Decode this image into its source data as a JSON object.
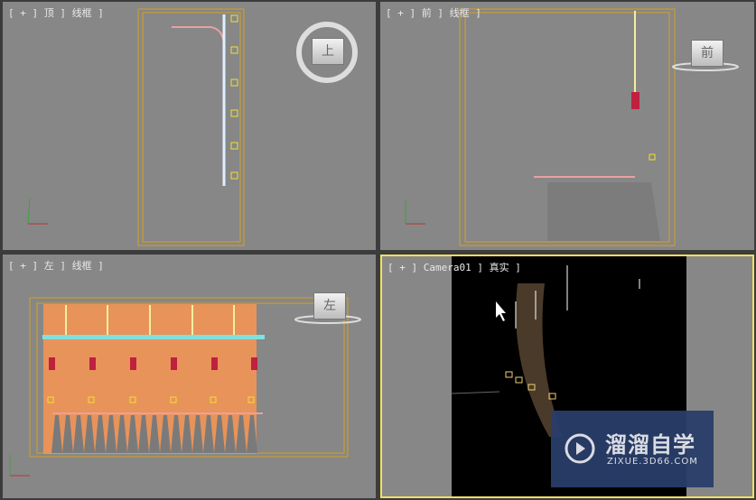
{
  "viewports": [
    {
      "label": "[ + ] 顶 ] 线框 ]",
      "viewcube": "上"
    },
    {
      "label": "[ + ] 前 ] 线框 ]",
      "viewcube": "前"
    },
    {
      "label": "[ + ] 左 ] 线框 ]",
      "viewcube": "左"
    },
    {
      "label": "[ + ] Camera01 ] 真实 ]"
    }
  ],
  "watermark": {
    "title": "溜溜自学",
    "url": "ZIXUE.3D66.COM"
  },
  "colors": {
    "viewport": "#878787",
    "active_border": "#f0e060",
    "frame": "#d4a020"
  }
}
